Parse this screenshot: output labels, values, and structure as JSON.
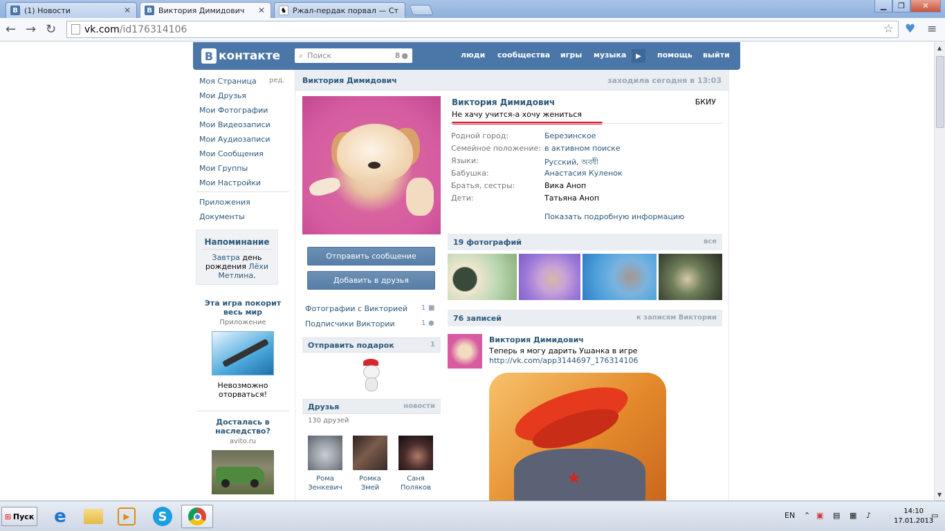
{
  "browser": {
    "tabs": [
      {
        "title": "(1) Новости",
        "favicon": "В",
        "active": false
      },
      {
        "title": "Виктория Димидович",
        "favicon": "В",
        "active": true
      },
      {
        "title": "Ржал-пердак порвал — Стр",
        "favicon": "",
        "active": false
      }
    ],
    "url_host": "vk.com",
    "url_path": "/id176314106"
  },
  "vk": {
    "logo_text": "контакте",
    "logo_letter": "В",
    "search_placeholder": "Поиск",
    "search_count": "8",
    "menu": [
      "люди",
      "сообщества",
      "игры",
      "музыка",
      "помощь",
      "выйти"
    ]
  },
  "left_menu": {
    "items": [
      "Моя Страница",
      "Мои Друзья",
      "Мои Фотографии",
      "Мои Видеозаписи",
      "Мои Аудиозаписи",
      "Мои Сообщения",
      "Мои Группы",
      "Мои Настройки"
    ],
    "edit": "ред.",
    "extra": [
      "Приложения",
      "Документы"
    ]
  },
  "reminder": {
    "title": "Напоминание",
    "link1": "Завтра",
    "t1": " день рождения ",
    "link2": "Лёхи Метлина",
    "t2": "."
  },
  "ads": [
    {
      "title": "Эта игра покорит весь мир",
      "sub": "Приложение",
      "text": "Невозможно оторваться!"
    },
    {
      "title": "Досталась в наследство?",
      "sub": "avito.ru"
    }
  ],
  "profile": {
    "header_name": "Виктория Димидович",
    "last_seen": "заходила сегодня в 13:03",
    "name": "Виктория Димидович",
    "university": "БКИУ",
    "status": "Не хачу учится-а хочу жениться",
    "info": [
      {
        "label": "Родной город:",
        "value": "Березинское",
        "link": true
      },
      {
        "label": "Семейное положение:",
        "value": "в активном поиске",
        "link": true
      },
      {
        "label": "Языки:",
        "value": "Русский, অবধী",
        "link": true
      },
      {
        "label": "Бабушка:",
        "value": "Анастасия Куленок",
        "link": true
      },
      {
        "label": "Братья, сестры:",
        "value": "Вика Аноп",
        "link": false
      },
      {
        "label": "Дети:",
        "value": "Татьяна Аноп",
        "link": false
      }
    ],
    "more_info": "Показать подробную информацию",
    "send_message": "Отправить сообщение",
    "add_friend": "Добавить в друзья",
    "photos_with": "Фотографии с Викторией",
    "photos_with_count": "1",
    "followers": "Подписчики Виктории",
    "followers_count": "1",
    "gift_title": "Отправить подарок",
    "gift_count": "1",
    "friends_title": "Друзья",
    "friends_news": "новости",
    "friends_count": "130 друзей",
    "friends": [
      {
        "first": "Рома",
        "last": "Зенкевич"
      },
      {
        "first": "Ромка",
        "last": "Змей"
      },
      {
        "first": "Саня",
        "last": "Поляков"
      }
    ]
  },
  "photos": {
    "title": "19 фотографий",
    "all": "все"
  },
  "wall": {
    "title": "76 записей",
    "to_posts": "к записям Виктории",
    "post_author": "Виктория Димидович",
    "post_text": "Теперь я могу дарить Ушанка в игре",
    "post_link": "http://vk.com/app3144697_176314106"
  },
  "taskbar": {
    "start": "Пуск",
    "lang": "EN",
    "time": "14:10",
    "date": "17.01.2013"
  },
  "colors": {
    "vk_blue": "#4a76a8",
    "link": "#2b587a",
    "status_underline": "#e0142d"
  }
}
